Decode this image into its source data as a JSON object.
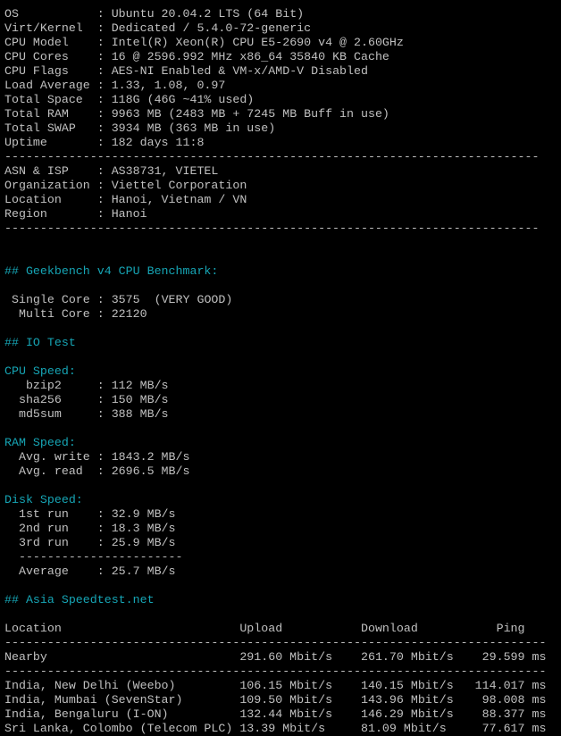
{
  "separator_long": "---------------------------------------------------------------------------",
  "system": [
    {
      "label": "OS",
      "value": "Ubuntu 20.04.2 LTS (64 Bit)"
    },
    {
      "label": "Virt/Kernel",
      "value": "Dedicated / 5.4.0-72-generic"
    },
    {
      "label": "CPU Model",
      "value": "Intel(R) Xeon(R) CPU E5-2690 v4 @ 2.60GHz"
    },
    {
      "label": "CPU Cores",
      "value": "16 @ 2596.992 MHz x86_64 35840 KB Cache"
    },
    {
      "label": "CPU Flags",
      "value": "AES-NI Enabled & VM-x/AMD-V Disabled"
    },
    {
      "label": "Load Average",
      "value": "1.33, 1.08, 0.97"
    },
    {
      "label": "Total Space",
      "value": "118G (46G ~41% used)"
    },
    {
      "label": "Total RAM",
      "value": "9963 MB (2483 MB + 7245 MB Buff in use)"
    },
    {
      "label": "Total SWAP",
      "value": "3934 MB (363 MB in use)"
    },
    {
      "label": "Uptime",
      "value": "182 days 11:8"
    }
  ],
  "network": [
    {
      "label": "ASN & ISP",
      "value": "AS38731, VIETEL"
    },
    {
      "label": "Organization",
      "value": "Viettel Corporation"
    },
    {
      "label": "Location",
      "value": "Hanoi, Vietnam / VN"
    },
    {
      "label": "Region",
      "value": "Hanoi"
    }
  ],
  "geekbench": {
    "heading": "## Geekbench v4 CPU Benchmark:",
    "single_label": "Single Core",
    "single_value": "3575",
    "single_rating": "(VERY GOOD)",
    "multi_label": "Multi Core",
    "multi_value": "22120"
  },
  "io_test": {
    "heading": "## IO Test",
    "cpu_speed_heading": "CPU Speed:",
    "cpu_speed": [
      {
        "label": "bzip2",
        "value": "112 MB/s"
      },
      {
        "label": "sha256",
        "value": "150 MB/s"
      },
      {
        "label": "md5sum",
        "value": "388 MB/s"
      }
    ],
    "ram_speed_heading": "RAM Speed:",
    "ram_speed": [
      {
        "label": "Avg. write",
        "value": "1843.2 MB/s"
      },
      {
        "label": "Avg. read",
        "value": "2696.5 MB/s"
      }
    ],
    "disk_speed_heading": "Disk Speed:",
    "disk_speed": [
      {
        "label": "1st run",
        "value": "32.9 MB/s"
      },
      {
        "label": "2nd run",
        "value": "18.3 MB/s"
      },
      {
        "label": "3rd run",
        "value": "25.9 MB/s"
      }
    ],
    "disk_separator": "-----------------------",
    "disk_average_label": "Average",
    "disk_average_value": "25.7 MB/s"
  },
  "speedtest": {
    "heading": "## Asia Speedtest.net",
    "columns": {
      "location": "Location",
      "upload": "Upload",
      "download": "Download",
      "ping": "Ping"
    },
    "separator": "----------------------------------------------------------------------------",
    "nearby": {
      "location": "Nearby",
      "upload": "291.60 Mbit/s",
      "download": "261.70 Mbit/s",
      "ping": "29.599 ms"
    },
    "rows": [
      {
        "location": "India, New Delhi (Weebo)",
        "upload": "106.15 Mbit/s",
        "download": "140.15 Mbit/s",
        "ping": "114.017 ms"
      },
      {
        "location": "India, Mumbai (SevenStar)",
        "upload": "109.50 Mbit/s",
        "download": "143.96 Mbit/s",
        "ping": "98.008 ms"
      },
      {
        "location": "India, Bengaluru (I-ON)",
        "upload": "132.44 Mbit/s",
        "download": "146.29 Mbit/s",
        "ping": "88.377 ms"
      },
      {
        "location": "Sri Lanka, Colombo (Telecom PLC)",
        "upload": "13.39 Mbit/s",
        "download": "81.09 Mbit/s",
        "ping": "77.617 ms"
      }
    ]
  },
  "colors": {
    "background": "#000000",
    "text": "#c0c0c0",
    "heading": "#16a5b5"
  }
}
